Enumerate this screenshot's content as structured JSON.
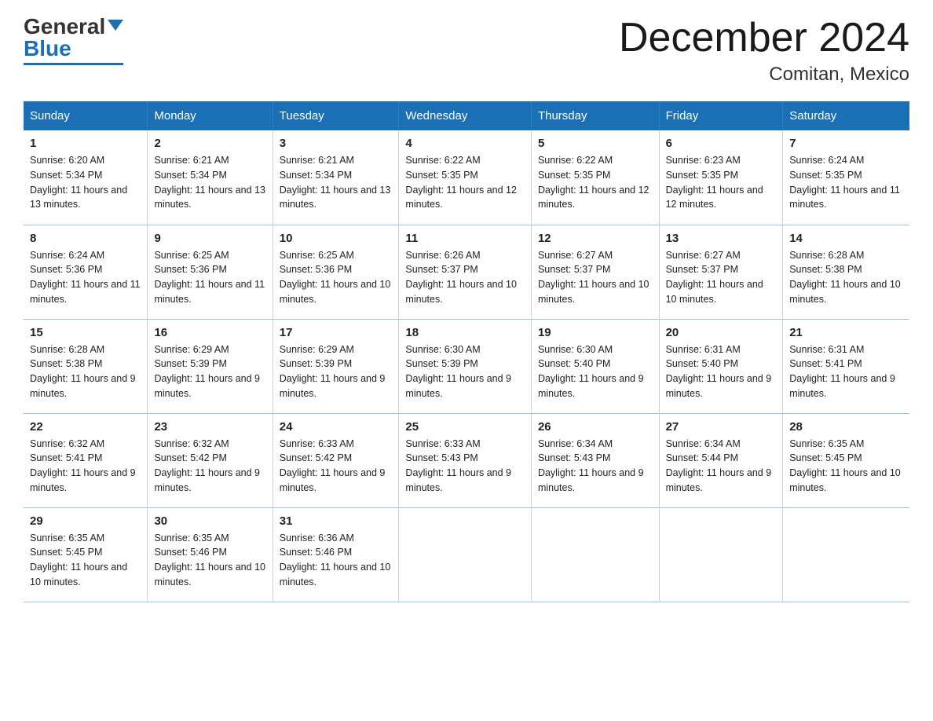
{
  "header": {
    "logo_general": "General",
    "logo_blue": "Blue",
    "month_title": "December 2024",
    "location": "Comitan, Mexico"
  },
  "days_of_week": [
    "Sunday",
    "Monday",
    "Tuesday",
    "Wednesday",
    "Thursday",
    "Friday",
    "Saturday"
  ],
  "weeks": [
    [
      {
        "day": "1",
        "sunrise": "6:20 AM",
        "sunset": "5:34 PM",
        "daylight": "11 hours and 13 minutes."
      },
      {
        "day": "2",
        "sunrise": "6:21 AM",
        "sunset": "5:34 PM",
        "daylight": "11 hours and 13 minutes."
      },
      {
        "day": "3",
        "sunrise": "6:21 AM",
        "sunset": "5:34 PM",
        "daylight": "11 hours and 13 minutes."
      },
      {
        "day": "4",
        "sunrise": "6:22 AM",
        "sunset": "5:35 PM",
        "daylight": "11 hours and 12 minutes."
      },
      {
        "day": "5",
        "sunrise": "6:22 AM",
        "sunset": "5:35 PM",
        "daylight": "11 hours and 12 minutes."
      },
      {
        "day": "6",
        "sunrise": "6:23 AM",
        "sunset": "5:35 PM",
        "daylight": "11 hours and 12 minutes."
      },
      {
        "day": "7",
        "sunrise": "6:24 AM",
        "sunset": "5:35 PM",
        "daylight": "11 hours and 11 minutes."
      }
    ],
    [
      {
        "day": "8",
        "sunrise": "6:24 AM",
        "sunset": "5:36 PM",
        "daylight": "11 hours and 11 minutes."
      },
      {
        "day": "9",
        "sunrise": "6:25 AM",
        "sunset": "5:36 PM",
        "daylight": "11 hours and 11 minutes."
      },
      {
        "day": "10",
        "sunrise": "6:25 AM",
        "sunset": "5:36 PM",
        "daylight": "11 hours and 10 minutes."
      },
      {
        "day": "11",
        "sunrise": "6:26 AM",
        "sunset": "5:37 PM",
        "daylight": "11 hours and 10 minutes."
      },
      {
        "day": "12",
        "sunrise": "6:27 AM",
        "sunset": "5:37 PM",
        "daylight": "11 hours and 10 minutes."
      },
      {
        "day": "13",
        "sunrise": "6:27 AM",
        "sunset": "5:37 PM",
        "daylight": "11 hours and 10 minutes."
      },
      {
        "day": "14",
        "sunrise": "6:28 AM",
        "sunset": "5:38 PM",
        "daylight": "11 hours and 10 minutes."
      }
    ],
    [
      {
        "day": "15",
        "sunrise": "6:28 AM",
        "sunset": "5:38 PM",
        "daylight": "11 hours and 9 minutes."
      },
      {
        "day": "16",
        "sunrise": "6:29 AM",
        "sunset": "5:39 PM",
        "daylight": "11 hours and 9 minutes."
      },
      {
        "day": "17",
        "sunrise": "6:29 AM",
        "sunset": "5:39 PM",
        "daylight": "11 hours and 9 minutes."
      },
      {
        "day": "18",
        "sunrise": "6:30 AM",
        "sunset": "5:39 PM",
        "daylight": "11 hours and 9 minutes."
      },
      {
        "day": "19",
        "sunrise": "6:30 AM",
        "sunset": "5:40 PM",
        "daylight": "11 hours and 9 minutes."
      },
      {
        "day": "20",
        "sunrise": "6:31 AM",
        "sunset": "5:40 PM",
        "daylight": "11 hours and 9 minutes."
      },
      {
        "day": "21",
        "sunrise": "6:31 AM",
        "sunset": "5:41 PM",
        "daylight": "11 hours and 9 minutes."
      }
    ],
    [
      {
        "day": "22",
        "sunrise": "6:32 AM",
        "sunset": "5:41 PM",
        "daylight": "11 hours and 9 minutes."
      },
      {
        "day": "23",
        "sunrise": "6:32 AM",
        "sunset": "5:42 PM",
        "daylight": "11 hours and 9 minutes."
      },
      {
        "day": "24",
        "sunrise": "6:33 AM",
        "sunset": "5:42 PM",
        "daylight": "11 hours and 9 minutes."
      },
      {
        "day": "25",
        "sunrise": "6:33 AM",
        "sunset": "5:43 PM",
        "daylight": "11 hours and 9 minutes."
      },
      {
        "day": "26",
        "sunrise": "6:34 AM",
        "sunset": "5:43 PM",
        "daylight": "11 hours and 9 minutes."
      },
      {
        "day": "27",
        "sunrise": "6:34 AM",
        "sunset": "5:44 PM",
        "daylight": "11 hours and 9 minutes."
      },
      {
        "day": "28",
        "sunrise": "6:35 AM",
        "sunset": "5:45 PM",
        "daylight": "11 hours and 10 minutes."
      }
    ],
    [
      {
        "day": "29",
        "sunrise": "6:35 AM",
        "sunset": "5:45 PM",
        "daylight": "11 hours and 10 minutes."
      },
      {
        "day": "30",
        "sunrise": "6:35 AM",
        "sunset": "5:46 PM",
        "daylight": "11 hours and 10 minutes."
      },
      {
        "day": "31",
        "sunrise": "6:36 AM",
        "sunset": "5:46 PM",
        "daylight": "11 hours and 10 minutes."
      },
      null,
      null,
      null,
      null
    ]
  ]
}
